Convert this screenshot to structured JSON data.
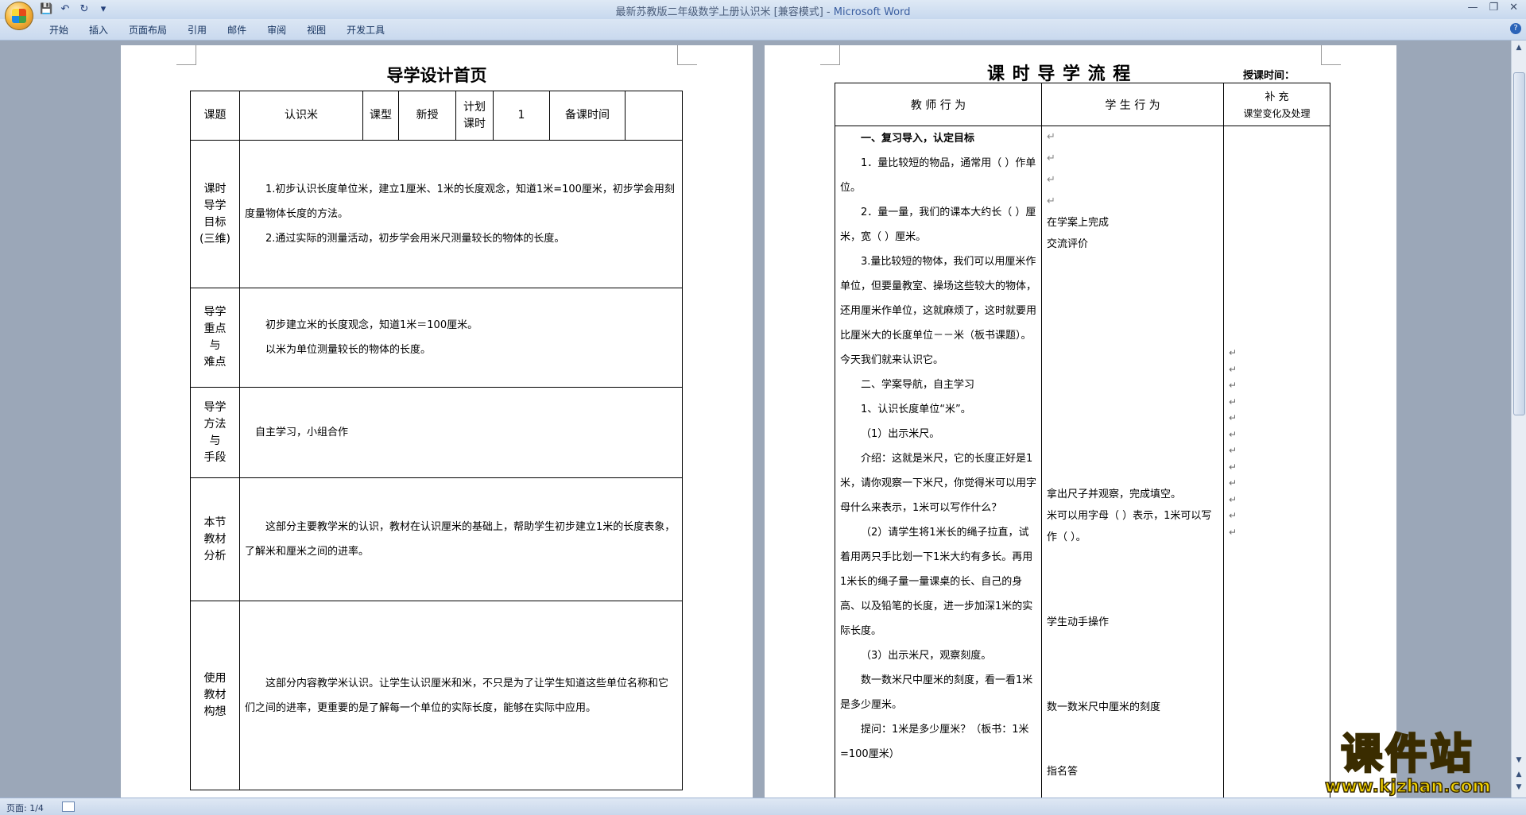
{
  "window": {
    "doc_title": "最新苏教版二年级数学上册认识米 [兼容模式]",
    "separator": " - ",
    "app_name": "Microsoft Word"
  },
  "quick_access": {
    "save_icon": "save-icon",
    "undo_icon": "undo-icon",
    "redo_icon": "redo-icon",
    "more": "▾"
  },
  "menu": {
    "items": [
      "开始",
      "插入",
      "页面布局",
      "引用",
      "邮件",
      "审阅",
      "视图",
      "开发工具"
    ]
  },
  "page1": {
    "title": "导学设计首页",
    "header": {
      "keti_label": "课题",
      "keti_value": "认识米",
      "kexing_label": "课型",
      "kexing_value": "新授",
      "jihua_label_1": "计划",
      "jihua_label_2": "课时",
      "jihua_value": "1",
      "beike_label": "备课时间",
      "beike_value": ""
    },
    "rows": {
      "goal_label": [
        "课时",
        "导学",
        "目标",
        "(三维)"
      ],
      "goal_p1": "1.初步认识长度单位米，建立1厘米、1米的长度观念，知道1米=100厘米，初步学会用刻度量物体长度的方法。",
      "goal_p2": "2.通过实际的测量活动，初步学会用米尺测量较长的物体的长度。",
      "key_label": [
        "导学",
        "重点",
        "与",
        "难点"
      ],
      "key_p1": "初步建立米的长度观念，知道1米＝100厘米。",
      "key_p2": "以米为单位测量较长的物体的长度。",
      "method_label": [
        "导学",
        "方法",
        "与",
        "手段"
      ],
      "method_p1": "自主学习，小组合作",
      "analysis_label": [
        "本节",
        "教材",
        "分析"
      ],
      "analysis_p1": "这部分主要教学米的认识，教材在认识厘米的基础上，帮助学生初步建立1米的长度表象，了解米和厘米之间的进率。",
      "use_label": [
        "使用",
        "教材",
        "构想"
      ],
      "use_p1": "这部分内容教学米认识。让学生认识厘米和米，不只是为了让学生知道这些单位名称和它们之间的进率，更重要的是了解每一个单位的实际长度，能够在实际中应用。"
    }
  },
  "page2": {
    "title": "课 时 导 学 流 程",
    "time_label": "授课时间：",
    "col_teacher": "教 师 行 为",
    "col_student": "学 生 行 为",
    "col_extra_1": "补  充",
    "col_extra_2": "课堂变化及处理",
    "teacher": [
      "一、复习导入，认定目标",
      "1．量比较短的物品，通常用（    ）作单位。",
      "2．量一量，我们的课本大约长（    ）厘米，宽（    ）厘米。",
      "3.量比较短的物体，我们可以用厘米作单位，但要量教室、操场这些较大的物体，还用厘米作单位，这就麻烦了，这时就要用比厘米大的长度单位－－米（板书课题）。今天我们就来认识它。",
      "二、学案导航，自主学习",
      "1、认识长度单位“米”。",
      "（1）出示米尺。",
      "介绍：这就是米尺，它的长度正好是1米，请你观察一下米尺，你觉得米可以用字母什么来表示，1米可以写作什么？",
      "（2）请学生将1米长的绳子拉直，试着用两只手比划一下1米大约有多长。再用1米长的绳子量一量课桌的长、自己的身高、以及铅笔的长度，进一步加深1米的实际长度。",
      "（3）出示米尺，观察刻度。",
      "数一数米尺中厘米的刻度，看一看1米是多少厘米。",
      "提问：1米是多少厘米？（板书：1米=100厘米）"
    ],
    "student_1": "在学案上完成",
    "student_2": "交流评价",
    "student_3": "拿出尺子并观察，完成填空。",
    "student_4": "米可以用字母（        ）表示，1米可以写作（        ）。",
    "student_5": "学生动手操作",
    "student_6": "数一数米尺中厘米的刻度",
    "student_7": "指名答"
  },
  "status": {
    "page": "页面: 1/4"
  },
  "watermark": {
    "big": "课件站",
    "url": "www.kjzhan.com"
  }
}
